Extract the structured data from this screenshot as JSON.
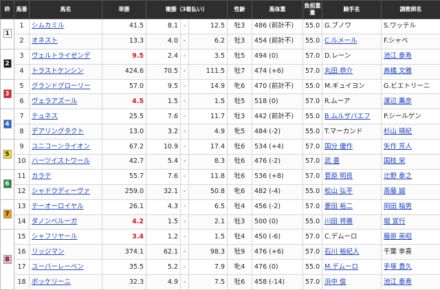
{
  "headers": {
    "frame": "枠",
    "number": "馬番",
    "horse": "馬名",
    "win": "単勝",
    "place": "複勝（3着払い）",
    "sexage": "性齢",
    "weight": "馬体重",
    "load": "負担重量",
    "jockey": "騎手名",
    "trainer": "調教師名"
  },
  "frame_colors": {
    "1": {
      "bg": "#ffffff",
      "fg": "#222222"
    },
    "2": {
      "bg": "#1e1e1e",
      "fg": "#ffffff"
    },
    "3": {
      "bg": "#d4252a",
      "fg": "#ffffff"
    },
    "4": {
      "bg": "#2a63c9",
      "fg": "#ffffff"
    },
    "5": {
      "bg": "#f2dc26",
      "fg": "#222222"
    },
    "6": {
      "bg": "#1f8a3a",
      "fg": "#ffffff"
    },
    "7": {
      "bg": "#f29a1d",
      "fg": "#222222"
    },
    "8": {
      "bg": "#f5a9c0",
      "fg": "#222222"
    }
  },
  "rows": [
    {
      "frame": "1",
      "num": "1",
      "horse": "シムカミル",
      "win": "41.5",
      "pl_lo": "8.1",
      "dash": "-",
      "pl_hi": "12.5",
      "sa": "牡3",
      "wt": "486 (前計不)",
      "ld": "55.0",
      "jk": "G.ブノワ",
      "jk_link": false,
      "tr": "S.ワッテル",
      "tr_link": false,
      "hot": false
    },
    {
      "frame": "1",
      "num": "2",
      "horse": "オネスト",
      "win": "13.3",
      "pl_lo": "4.0",
      "dash": "-",
      "pl_hi": "6.2",
      "sa": "牡3",
      "wt": "454 (前計不)",
      "ld": "55.0",
      "jk": "C.ルメール",
      "jk_link": true,
      "tr": "F.シャベ",
      "tr_link": false,
      "hot": false
    },
    {
      "frame": "2",
      "num": "3",
      "horse": "ヴェルトライゼンデ",
      "win": "9.5",
      "pl_lo": "2.4",
      "dash": "-",
      "pl_hi": "3.5",
      "sa": "牡5",
      "wt": "494 (0)",
      "ld": "57.0",
      "jk": "D.レーン",
      "jk_link": false,
      "tr": "池江 泰寿",
      "tr_link": true,
      "hot": true
    },
    {
      "frame": "2",
      "num": "4",
      "horse": "トラストケンシン",
      "win": "424.6",
      "pl_lo": "70.5",
      "dash": "-",
      "pl_hi": "111.5",
      "sa": "牡7",
      "wt": "474 (+6)",
      "ld": "57.0",
      "jk": "丸田 恭介",
      "jk_link": true,
      "tr": "高橋 文雅",
      "tr_link": true,
      "hot": false
    },
    {
      "frame": "3",
      "num": "5",
      "horse": "グランドグローリー",
      "win": "57.0",
      "pl_lo": "9.5",
      "dash": "-",
      "pl_hi": "14.9",
      "sa": "牝6",
      "wt": "470 (前計不)",
      "ld": "55.0",
      "jk": "M.ギュイヨン",
      "jk_link": false,
      "tr": "G.ビエトリーニ",
      "tr_link": false,
      "hot": false
    },
    {
      "frame": "3",
      "num": "6",
      "horse": "ヴェラアズール",
      "win": "4.5",
      "pl_lo": "1.5",
      "dash": "-",
      "pl_hi": "1.5",
      "sa": "牡5",
      "wt": "518 (0)",
      "ld": "57.0",
      "jk": "R.ムーア",
      "jk_link": false,
      "tr": "渡辺 薫彦",
      "tr_link": true,
      "hot": true
    },
    {
      "frame": "4",
      "num": "7",
      "horse": "テュネス",
      "win": "25.5",
      "pl_lo": "7.6",
      "dash": "-",
      "pl_hi": "11.7",
      "sa": "牡3",
      "wt": "442 (前計不)",
      "ld": "55.0",
      "jk": "B.ムルザバエフ",
      "jk_link": true,
      "tr": "P.シールゲン",
      "tr_link": false,
      "hot": false
    },
    {
      "frame": "4",
      "num": "8",
      "horse": "デアリングタクト",
      "win": "13.0",
      "pl_lo": "3.2",
      "dash": "-",
      "pl_hi": "4.9",
      "sa": "牝5",
      "wt": "484 (-2)",
      "ld": "55.0",
      "jk": "T.マーカンド",
      "jk_link": false,
      "tr": "杉山 晴紀",
      "tr_link": true,
      "hot": false
    },
    {
      "frame": "5",
      "num": "9",
      "horse": "ユニコーンライオン",
      "win": "67.2",
      "pl_lo": "10.9",
      "dash": "-",
      "pl_hi": "17.4",
      "sa": "牡6",
      "wt": "534 (+4)",
      "ld": "57.0",
      "jk": "国分 優作",
      "jk_link": true,
      "tr": "矢作 芳人",
      "tr_link": true,
      "hot": false
    },
    {
      "frame": "5",
      "num": "10",
      "horse": "ハーツイストワール",
      "win": "42.7",
      "pl_lo": "5.4",
      "dash": "-",
      "pl_hi": "8.3",
      "sa": "牡6",
      "wt": "476 (-2)",
      "ld": "57.0",
      "jk": "武 豊",
      "jk_link": true,
      "tr": "国枝 栄",
      "tr_link": true,
      "hot": false
    },
    {
      "frame": "6",
      "num": "11",
      "horse": "カラテ",
      "win": "55.7",
      "pl_lo": "7.6",
      "dash": "-",
      "pl_hi": "11.8",
      "sa": "牡6",
      "wt": "536 (+8)",
      "ld": "57.0",
      "jk": "菅原 明良",
      "jk_link": true,
      "tr": "辻野 泰之",
      "tr_link": true,
      "hot": false
    },
    {
      "frame": "6",
      "num": "12",
      "horse": "シャドウディーヴァ",
      "win": "259.0",
      "pl_lo": "32.1",
      "dash": "-",
      "pl_hi": "50.8",
      "sa": "牝6",
      "wt": "482 (-4)",
      "ld": "55.0",
      "jk": "松山 弘平",
      "jk_link": true,
      "tr": "斎藤 誠",
      "tr_link": true,
      "hot": false
    },
    {
      "frame": "7",
      "num": "13",
      "horse": "テーオーロイヤル",
      "win": "26.1",
      "pl_lo": "4.3",
      "dash": "-",
      "pl_hi": "6.5",
      "sa": "牡4",
      "wt": "456 (-2)",
      "ld": "57.0",
      "jk": "菱田 裕二",
      "jk_link": true,
      "tr": "岡田 稲男",
      "tr_link": true,
      "hot": false
    },
    {
      "frame": "7",
      "num": "14",
      "horse": "ダノンベルーガ",
      "win": "4.2",
      "pl_lo": "1.5",
      "dash": "-",
      "pl_hi": "2.1",
      "sa": "牡3",
      "wt": "500 (0)",
      "ld": "55.0",
      "jk": "川田 将雅",
      "jk_link": true,
      "tr": "堀 宣行",
      "tr_link": true,
      "hot": true
    },
    {
      "frame": "8",
      "num": "15",
      "horse": "シャフリヤール",
      "win": "3.4",
      "pl_lo": "1.2",
      "dash": "-",
      "pl_hi": "1.5",
      "sa": "牡4",
      "wt": "450 (-6)",
      "ld": "57.0",
      "jk": "C.デムーロ",
      "jk_link": false,
      "tr": "藤原 英昭",
      "tr_link": true,
      "hot": true
    },
    {
      "frame": "8",
      "num": "16",
      "horse": "リッジマン",
      "win": "374.1",
      "pl_lo": "62.1",
      "dash": "-",
      "pl_hi": "98.3",
      "sa": "牡9",
      "wt": "476 (+6)",
      "ld": "57.0",
      "jk": "石川 裕紀人",
      "jk_link": true,
      "tr": "千葉 幸喜",
      "tr_link": false,
      "hot": false
    },
    {
      "frame": "8",
      "num": "17",
      "horse": "ユーバーレーベン",
      "win": "35.5",
      "pl_lo": "5.2",
      "dash": "-",
      "pl_hi": "7.9",
      "sa": "牝4",
      "wt": "476 (0)",
      "ld": "55.0",
      "jk": "M.デムーロ",
      "jk_link": true,
      "tr": "手塚 貴久",
      "tr_link": true,
      "hot": false
    },
    {
      "frame": "8",
      "num": "18",
      "horse": "ボッケリーニ",
      "win": "32.3",
      "pl_lo": "4.9",
      "dash": "-",
      "pl_hi": "7.5",
      "sa": "牡6",
      "wt": "458 (-14)",
      "ld": "57.0",
      "jk": "浜中 俊",
      "jk_link": true,
      "tr": "池江 泰寿",
      "tr_link": true,
      "hot": false
    }
  ]
}
